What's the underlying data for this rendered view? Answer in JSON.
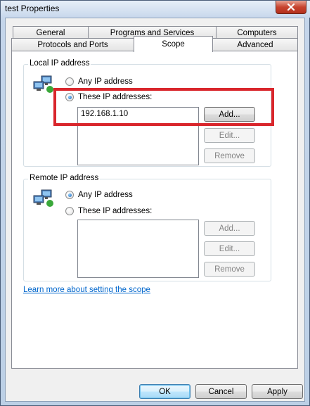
{
  "window": {
    "title": "test Properties"
  },
  "tabs_row1": [
    "General",
    "Programs and Services",
    "Computers"
  ],
  "tabs_row2": [
    "Protocols and Ports",
    "Scope",
    "Advanced"
  ],
  "local": {
    "label": "Local IP address",
    "any_label": "Any IP address",
    "these_label": "These IP addresses:",
    "selected": "these",
    "entries": [
      "192.168.1.10"
    ],
    "add": "Add...",
    "edit": "Edit...",
    "remove": "Remove"
  },
  "remote": {
    "label": "Remote IP address",
    "any_label": "Any IP address",
    "these_label": "These IP addresses:",
    "selected": "any",
    "entries": [],
    "add": "Add...",
    "edit": "Edit...",
    "remove": "Remove"
  },
  "learn_more": "Learn more about setting the scope",
  "footer": {
    "ok": "OK",
    "cancel": "Cancel",
    "apply": "Apply"
  },
  "colors": {
    "highlight": "#d9262c",
    "link": "#0066cc"
  }
}
